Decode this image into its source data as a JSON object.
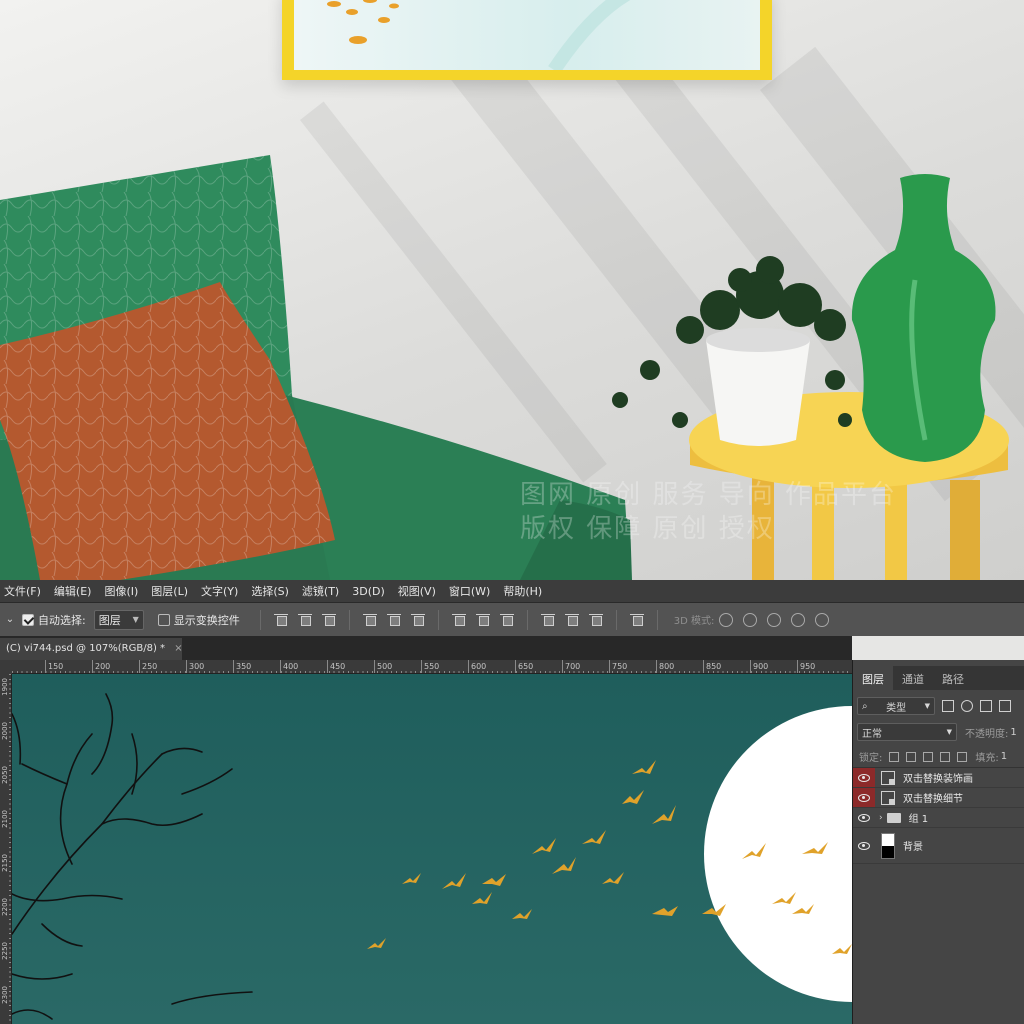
{
  "photo": {
    "watermark_line1": "图网  原创  服务  导向  作品平台",
    "watermark_line2": "版权  保障  原创  授权"
  },
  "menubar": {
    "items": [
      "文件(F)",
      "编辑(E)",
      "图像(I)",
      "图层(L)",
      "文字(Y)",
      "选择(S)",
      "滤镜(T)",
      "3D(D)",
      "视图(V)",
      "窗口(W)",
      "帮助(H)"
    ]
  },
  "options": {
    "auto_select_label": "自动选择:",
    "auto_select_target": "图层",
    "show_transform_label": "显示变换控件",
    "mode_3d_label": "3D 模式:"
  },
  "document": {
    "tab_label": "(C) vi744.psd @ 107%(RGB/8) *",
    "close_glyph": "×"
  },
  "ruler": {
    "h_ticks": [
      "150",
      "200",
      "250",
      "300",
      "350",
      "400",
      "450",
      "500",
      "550",
      "600",
      "650",
      "700",
      "750",
      "800",
      "850",
      "900",
      "950"
    ],
    "v_ticks": [
      "1900",
      "2000",
      "2050",
      "2100",
      "2150",
      "2200",
      "2250",
      "2300"
    ]
  },
  "layers_panel": {
    "tabs": [
      "图层",
      "通道",
      "路径"
    ],
    "active_tab": "图层",
    "filter_kind": "类型",
    "blend_mode": "正常",
    "opacity_label": "不透明度:",
    "opacity_value": "1",
    "lock_label": "锁定:",
    "fill_label": "填充:",
    "fill_value": "1",
    "layers": [
      {
        "name": "双击替换装饰画",
        "kind": "smart",
        "eye_highlight": true
      },
      {
        "name": "双击替换细节",
        "kind": "smart",
        "eye_highlight": true
      },
      {
        "name": "组 1",
        "kind": "group",
        "eye_highlight": false
      },
      {
        "name": "背景",
        "kind": "background",
        "eye_highlight": false
      }
    ]
  },
  "colors": {
    "canvas_teal": "#1f5e5c",
    "armchair_green": "#2e8a5c",
    "pillow_rust": "#b55b34",
    "side_table_yellow": "#f2c845",
    "vase_green": "#2a9a4c",
    "frame_yellow": "#f4d429",
    "bird_gold": "#e0a22a",
    "eye_highlight_red": "#8c2a2a"
  }
}
